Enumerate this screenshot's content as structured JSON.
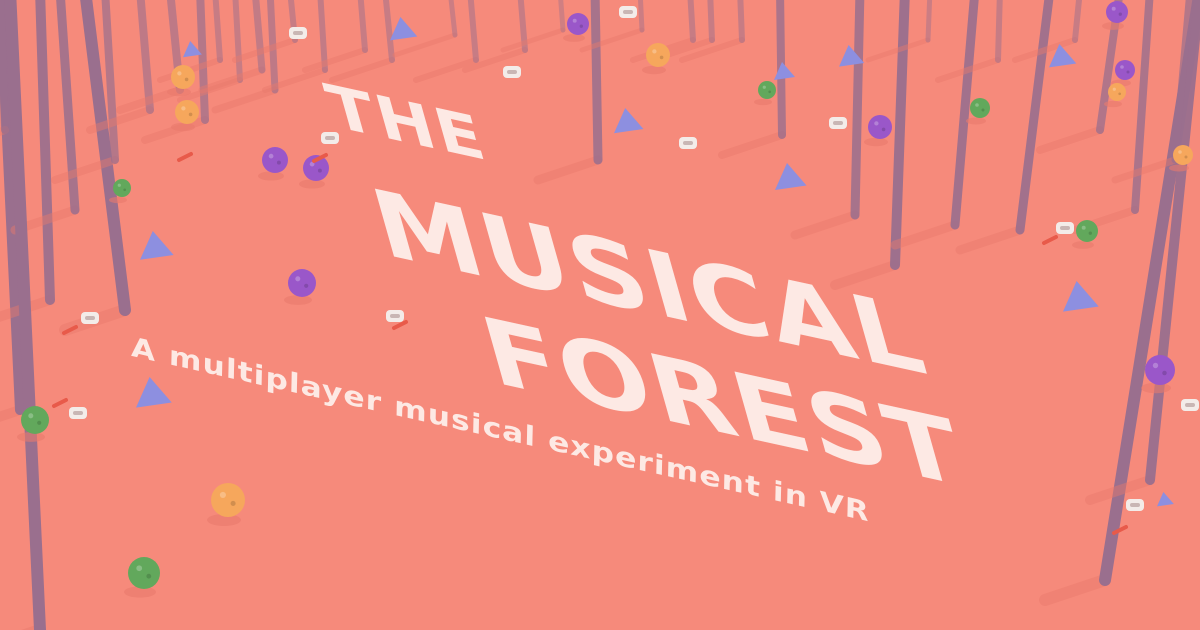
{
  "title": {
    "line1": "THE",
    "line2": "MUSICAL",
    "line3": "FOREST"
  },
  "subtitle": "A multiplayer musical experiment in VR",
  "colors": {
    "ground": "#f68a7b",
    "trunk": "#9a6f8e",
    "shadow": "#e97a6c",
    "text": "#fde9e4",
    "sphere_purple": "#9a57c9",
    "sphere_orange": "#f6a75c",
    "sphere_green": "#62a85c",
    "pyramid_blue": "#8d8fe0"
  },
  "icons": [
    "tree-trunk-icon",
    "purple-sphere-icon",
    "orange-sphere-icon",
    "green-sphere-icon",
    "blue-pyramid-icon",
    "vr-headset-icon",
    "controller-hand-icon"
  ]
}
